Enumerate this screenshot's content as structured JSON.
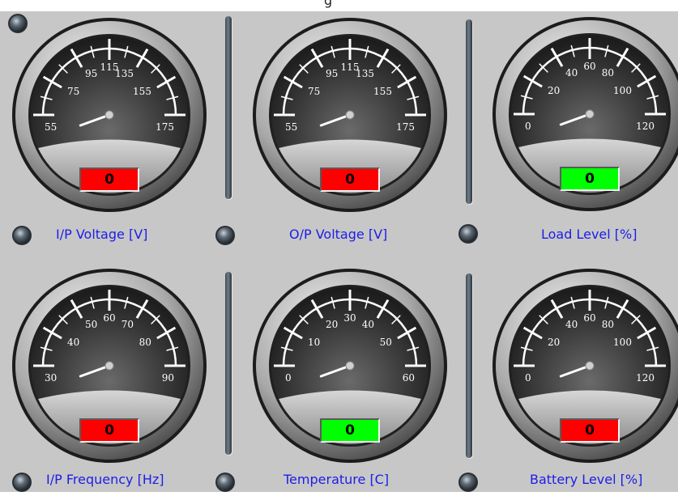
{
  "header": {
    "title": "g"
  },
  "gauges": [
    {
      "caption": "I/P Voltage [V]",
      "ticks": [
        "55",
        "75",
        "95",
        "115",
        "135",
        "155",
        "175"
      ],
      "reading": "0",
      "readout_color": "#ff0000"
    },
    {
      "caption": "O/P Voltage [V]",
      "ticks": [
        "55",
        "75",
        "95",
        "115",
        "135",
        "155",
        "175"
      ],
      "reading": "0",
      "readout_color": "#ff0000"
    },
    {
      "caption": "Load Level [%]",
      "ticks": [
        "0",
        "20",
        "40",
        "60",
        "80",
        "100",
        "120"
      ],
      "reading": "0",
      "readout_color": "#00ff00"
    },
    {
      "caption": "I/P Frequency [Hz]",
      "ticks": [
        "30",
        "40",
        "50",
        "60",
        "70",
        "80",
        "90"
      ],
      "reading": "0",
      "readout_color": "#ff0000"
    },
    {
      "caption": "Temperature [C]",
      "ticks": [
        "0",
        "10",
        "20",
        "30",
        "40",
        "50",
        "60"
      ],
      "reading": "0",
      "readout_color": "#00ff00"
    },
    {
      "caption": "Battery Level [%]",
      "ticks": [
        "0",
        "20",
        "40",
        "60",
        "80",
        "100",
        "120"
      ],
      "reading": "0",
      "readout_color": "#ff0000"
    }
  ],
  "colors": {
    "panel_background": "#c7c7c7",
    "caption_text": "#1d1de8",
    "alarm_red": "#ff0000",
    "ok_green": "#00ff00"
  }
}
